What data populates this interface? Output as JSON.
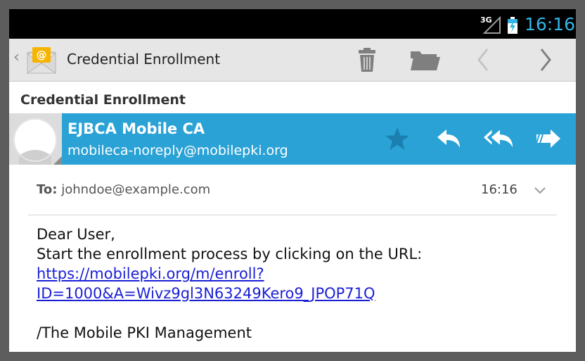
{
  "status_bar": {
    "network": "3G",
    "time": "16:16"
  },
  "action_bar": {
    "title": "Credential Enrollment",
    "icons": [
      "up-caret-icon",
      "email-app-icon",
      "trash-icon",
      "folder-icon",
      "chevron-left-icon",
      "chevron-right-icon"
    ]
  },
  "subject": "Credential Enrollment",
  "sender": {
    "name": "EJBCA Mobile CA",
    "email": "mobileca-noreply@mobilepki.org",
    "icons": [
      "star-icon",
      "reply-icon",
      "reply-all-icon",
      "forward-icon"
    ]
  },
  "recipient": {
    "label": "To:",
    "address": "johndoe@example.com",
    "time": "16:16"
  },
  "body": {
    "greeting": "Dear User,",
    "instruction": "Start the enrollment process by clicking on the URL:",
    "link_line1": "https://mobilepki.org/m/enroll?",
    "link_line2": "ID=1000&A=Wivz9gl3N63249Kero9_JPOP71Q",
    "signature": "/The Mobile PKI Management"
  },
  "colors": {
    "accent": "#2aa2d6",
    "clock": "#33b5e5",
    "link": "#1a1fd6",
    "action_bar": "#e6e6e6"
  }
}
